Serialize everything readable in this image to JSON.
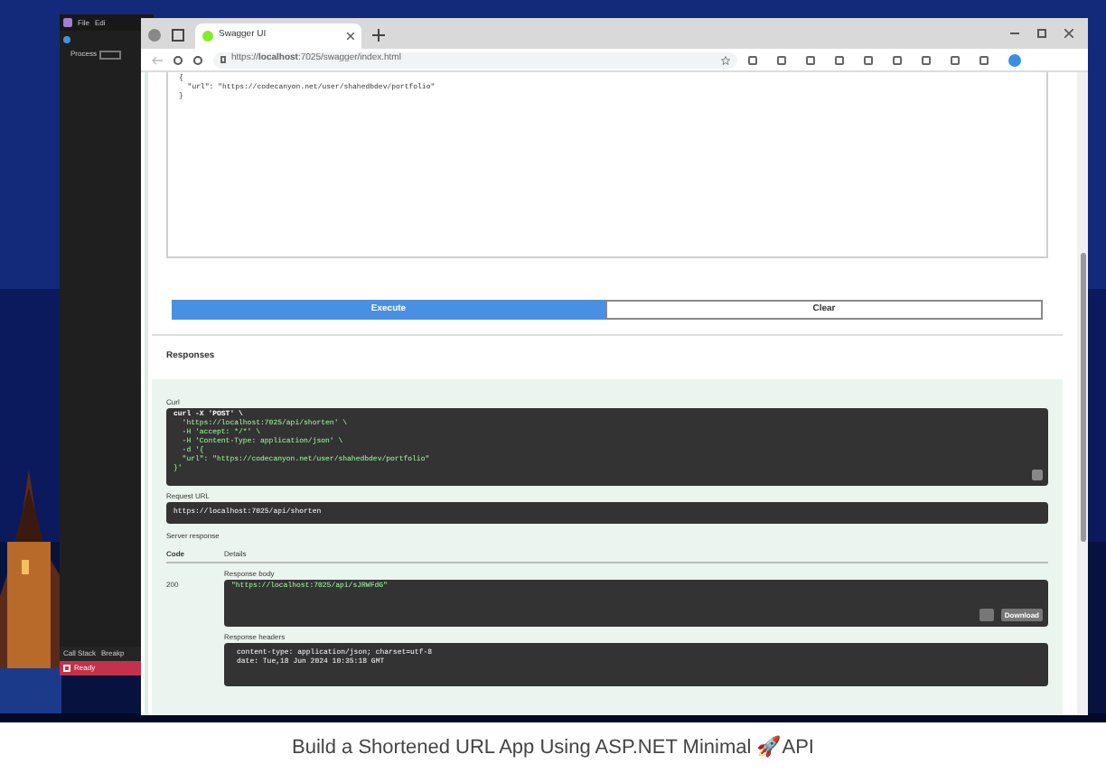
{
  "ide": {
    "menu": [
      "File",
      "Edi"
    ],
    "process_label": "Process",
    "bottom_tabs": [
      "Call Stack",
      "Breakp"
    ],
    "status": "Ready"
  },
  "browser": {
    "tab_title": "Swagger UI",
    "url": "https://**localhost**:7025/swagger/index.html"
  },
  "request_body": {
    "lines": [
      "{",
      "  \"url\": \"https://codecanyon.net/user/shahedbdev/portfolio\"",
      "}"
    ]
  },
  "buttons": [
    {
      "label": "Execute",
      "kind": "primary"
    },
    {
      "label": "Clear",
      "kind": "secondary"
    }
  ],
  "responses": {
    "title": "Responses",
    "curl_label": "Curl",
    "curl_lines": [
      "curl -X 'POST' \\",
      "  'https://localhost:7025/api/shorten' \\",
      "  -H 'accept: */*' \\",
      "  -H 'Content-Type: application/json' \\",
      "  -d '{",
      "  \"url\": \"https://codecanyon.net/user/shahedbdev/portfolio\"",
      "}'"
    ],
    "request_url_label": "Request URL",
    "request_url": "https://localhost:7025/api/shorten",
    "server_response_label": "Server response",
    "columns": [
      "Code",
      "Details"
    ],
    "code": "200",
    "body_label": "Response body",
    "body": "\"https://localhost:7025/api/sJRWFdG\"",
    "download": "Download",
    "headers_label": "Response headers",
    "headers": [
      "content-type: application/json; charset=utf-8",
      "date: Tue,18 Jun 2024 10:35:18 GMT"
    ]
  },
  "caption": "Build a Shortened URL App Using ASP.NET Minimal 🚀API"
}
